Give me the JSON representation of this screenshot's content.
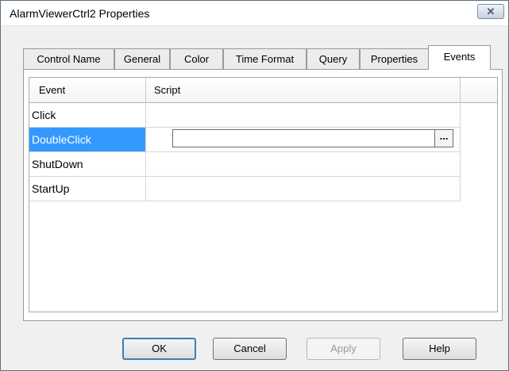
{
  "window": {
    "title": "AlarmViewerCtrl2 Properties",
    "close_glyph": "✕"
  },
  "tabs": [
    {
      "label": "Control Name"
    },
    {
      "label": "General"
    },
    {
      "label": "Color"
    },
    {
      "label": "Time Format"
    },
    {
      "label": "Query"
    },
    {
      "label": "Properties"
    },
    {
      "label": "Events",
      "active": true
    }
  ],
  "grid": {
    "columns": [
      "Event",
      "Script"
    ],
    "rows": [
      {
        "event": "Click",
        "script": ""
      },
      {
        "event": "DoubleClick",
        "script": "",
        "selected": true
      },
      {
        "event": "ShutDown",
        "script": ""
      },
      {
        "event": "StartUp",
        "script": ""
      }
    ],
    "browse_label": "..."
  },
  "buttons": {
    "ok": "OK",
    "cancel": "Cancel",
    "apply": "Apply",
    "help": "Help"
  },
  "colors": {
    "selection": "#3399ff",
    "default_button_border": "#3c7fb1"
  }
}
